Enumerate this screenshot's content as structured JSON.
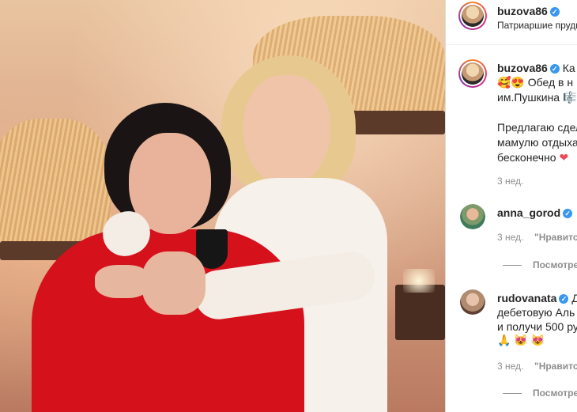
{
  "post": {
    "author": "buzova86",
    "location": "Патриаршие пруды",
    "caption_line1": "Ка",
    "caption_line2": "🥰😍 Обед в н",
    "caption_line3": "им.Пушкина 🎼",
    "caption_line4": "Предлагаю сдел",
    "caption_line5": "мамулю отдыха",
    "caption_line6": "бесконечно",
    "caption_heart": "❤",
    "time": "3 нед."
  },
  "comments": [
    {
      "user": "anna_gorod",
      "time": "3 нед.",
      "like_label": "\"Нравится",
      "view_replies": "Посмотре"
    },
    {
      "user": "rudovanata",
      "line1": "Д",
      "line2": "дебетовую Аль",
      "line3": "и получи 500 ру",
      "line4": "🙏 😻 😻",
      "time": "3 нед.",
      "like_label": "\"Нравится",
      "view_replies": "Посмотре"
    }
  ],
  "icons": {
    "verified": "verified-badge-icon"
  },
  "colors": {
    "verified": "#3897f0",
    "accent_red": "#d5111c",
    "meta_gray": "#8e8e8e"
  }
}
